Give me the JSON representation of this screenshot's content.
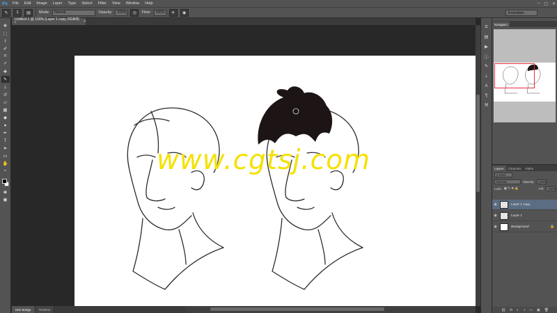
{
  "app": {
    "logo": "Ps"
  },
  "menu": [
    "File",
    "Edit",
    "Image",
    "Layer",
    "Type",
    "Select",
    "Filter",
    "View",
    "Window",
    "Help"
  ],
  "window_controls": {
    "minimize": "–",
    "restore": "▢",
    "close": "✕"
  },
  "options": {
    "mode_label": "Mode:",
    "mode_value": "Normal",
    "opacity_label": "Opacity:",
    "opacity_value": "100%",
    "flow_label": "Flow:",
    "flow_value": "100%",
    "workspace": "Essentials",
    "brush_size": "1"
  },
  "document": {
    "tab_title": "Untitled-1 @ 100% (Layer 1 copy, RGB/8) *",
    "close": "×"
  },
  "watermark": "www.cgtsj.com",
  "bottom_tabs": [
    "Mini Bridge",
    "Timeline"
  ],
  "navigator": {
    "tab": "Navigator"
  },
  "layers_panel": {
    "tabs": [
      "Layers",
      "Channels",
      "Paths"
    ],
    "kind_label": "ρ Kind",
    "blend_mode": "Normal",
    "opacity_label": "Opacity:",
    "opacity_value": "100%",
    "lock_label": "Lock:",
    "fill_label": "Fill:",
    "fill_value": "100%",
    "layers": [
      {
        "name": "Layer 1 copy",
        "selected": true
      },
      {
        "name": "Layer 1",
        "selected": false
      },
      {
        "name": "Background",
        "selected": false
      }
    ],
    "footer_icons": [
      "⛓",
      "fx",
      "◐",
      "◑",
      "▭",
      "▣",
      "🗑"
    ]
  },
  "tools": [
    "move-tool",
    "marquee-tool",
    "lasso-tool",
    "quick-select-tool",
    "crop-tool",
    "eyedropper-tool",
    "healing-tool",
    "brush-tool",
    "clone-stamp-tool",
    "history-brush-tool",
    "eraser-tool",
    "gradient-tool",
    "blur-tool",
    "dodge-tool",
    "pen-tool",
    "type-tool",
    "path-select-tool",
    "shape-tool",
    "hand-tool",
    "zoom-tool"
  ]
}
